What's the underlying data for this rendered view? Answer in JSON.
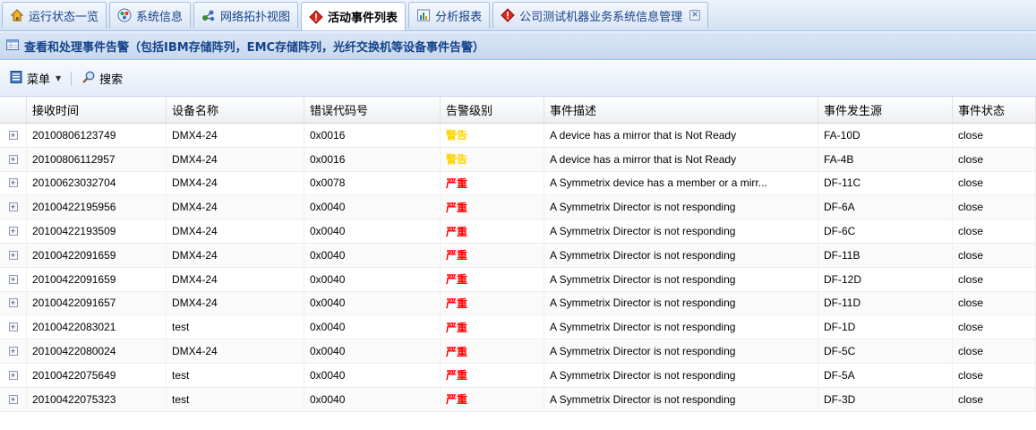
{
  "tabs": [
    {
      "label": "运行状态一览",
      "icon": "home-icon",
      "active": false
    },
    {
      "label": "系统信息",
      "icon": "system-info-icon",
      "active": false
    },
    {
      "label": "网络拓扑视图",
      "icon": "network-topology-icon",
      "active": false
    },
    {
      "label": "活动事件列表",
      "icon": "alert-diamond-icon",
      "active": true
    },
    {
      "label": "分析报表",
      "icon": "report-icon",
      "active": false
    },
    {
      "label": "公司测试机器业务系统信息管理",
      "icon": "alert-diamond-icon",
      "active": false,
      "closable": true
    }
  ],
  "panel": {
    "title": "查看和处理事件告警（包括IBM存储阵列，EMC存储阵列，光纤交换机等设备事件告警）"
  },
  "toolbar": {
    "menu_label": "菜单",
    "search_label": "搜索"
  },
  "grid": {
    "columns": [
      "接收时间",
      "设备名称",
      "错误代码号",
      "告警级别",
      "事件描述",
      "事件发生源",
      "事件状态"
    ],
    "level_colors": {
      "警告": "#ffd200",
      "严重": "#ff0000"
    },
    "rows": [
      [
        "20100806123749",
        "DMX4-24",
        "0x0016",
        "警告",
        "A device has a mirror that is Not Ready",
        "FA-10D",
        "close"
      ],
      [
        "20100806112957",
        "DMX4-24",
        "0x0016",
        "警告",
        "A device has a mirror that is Not Ready",
        "FA-4B",
        "close"
      ],
      [
        "20100623032704",
        "DMX4-24",
        "0x0078",
        "严重",
        "A Symmetrix device has a member or a mirr...",
        "DF-11C",
        "close"
      ],
      [
        "20100422195956",
        "DMX4-24",
        "0x0040",
        "严重",
        "A Symmetrix Director is not responding",
        "DF-6A",
        "close"
      ],
      [
        "20100422193509",
        "DMX4-24",
        "0x0040",
        "严重",
        "A Symmetrix Director is not responding",
        "DF-6C",
        "close"
      ],
      [
        "20100422091659",
        "DMX4-24",
        "0x0040",
        "严重",
        "A Symmetrix Director is not responding",
        "DF-11B",
        "close"
      ],
      [
        "20100422091659",
        "DMX4-24",
        "0x0040",
        "严重",
        "A Symmetrix Director is not responding",
        "DF-12D",
        "close"
      ],
      [
        "20100422091657",
        "DMX4-24",
        "0x0040",
        "严重",
        "A Symmetrix Director is not responding",
        "DF-11D",
        "close"
      ],
      [
        "20100422083021",
        "test",
        "0x0040",
        "严重",
        "A Symmetrix Director is not responding",
        "DF-1D",
        "close"
      ],
      [
        "20100422080024",
        "DMX4-24",
        "0x0040",
        "严重",
        "A Symmetrix Director is not responding",
        "DF-5C",
        "close"
      ],
      [
        "20100422075649",
        "test",
        "0x0040",
        "严重",
        "A Symmetrix Director is not responding",
        "DF-5A",
        "close"
      ],
      [
        "20100422075323",
        "test",
        "0x0040",
        "严重",
        "A Symmetrix Director is not responding",
        "DF-3D",
        "close"
      ]
    ]
  }
}
